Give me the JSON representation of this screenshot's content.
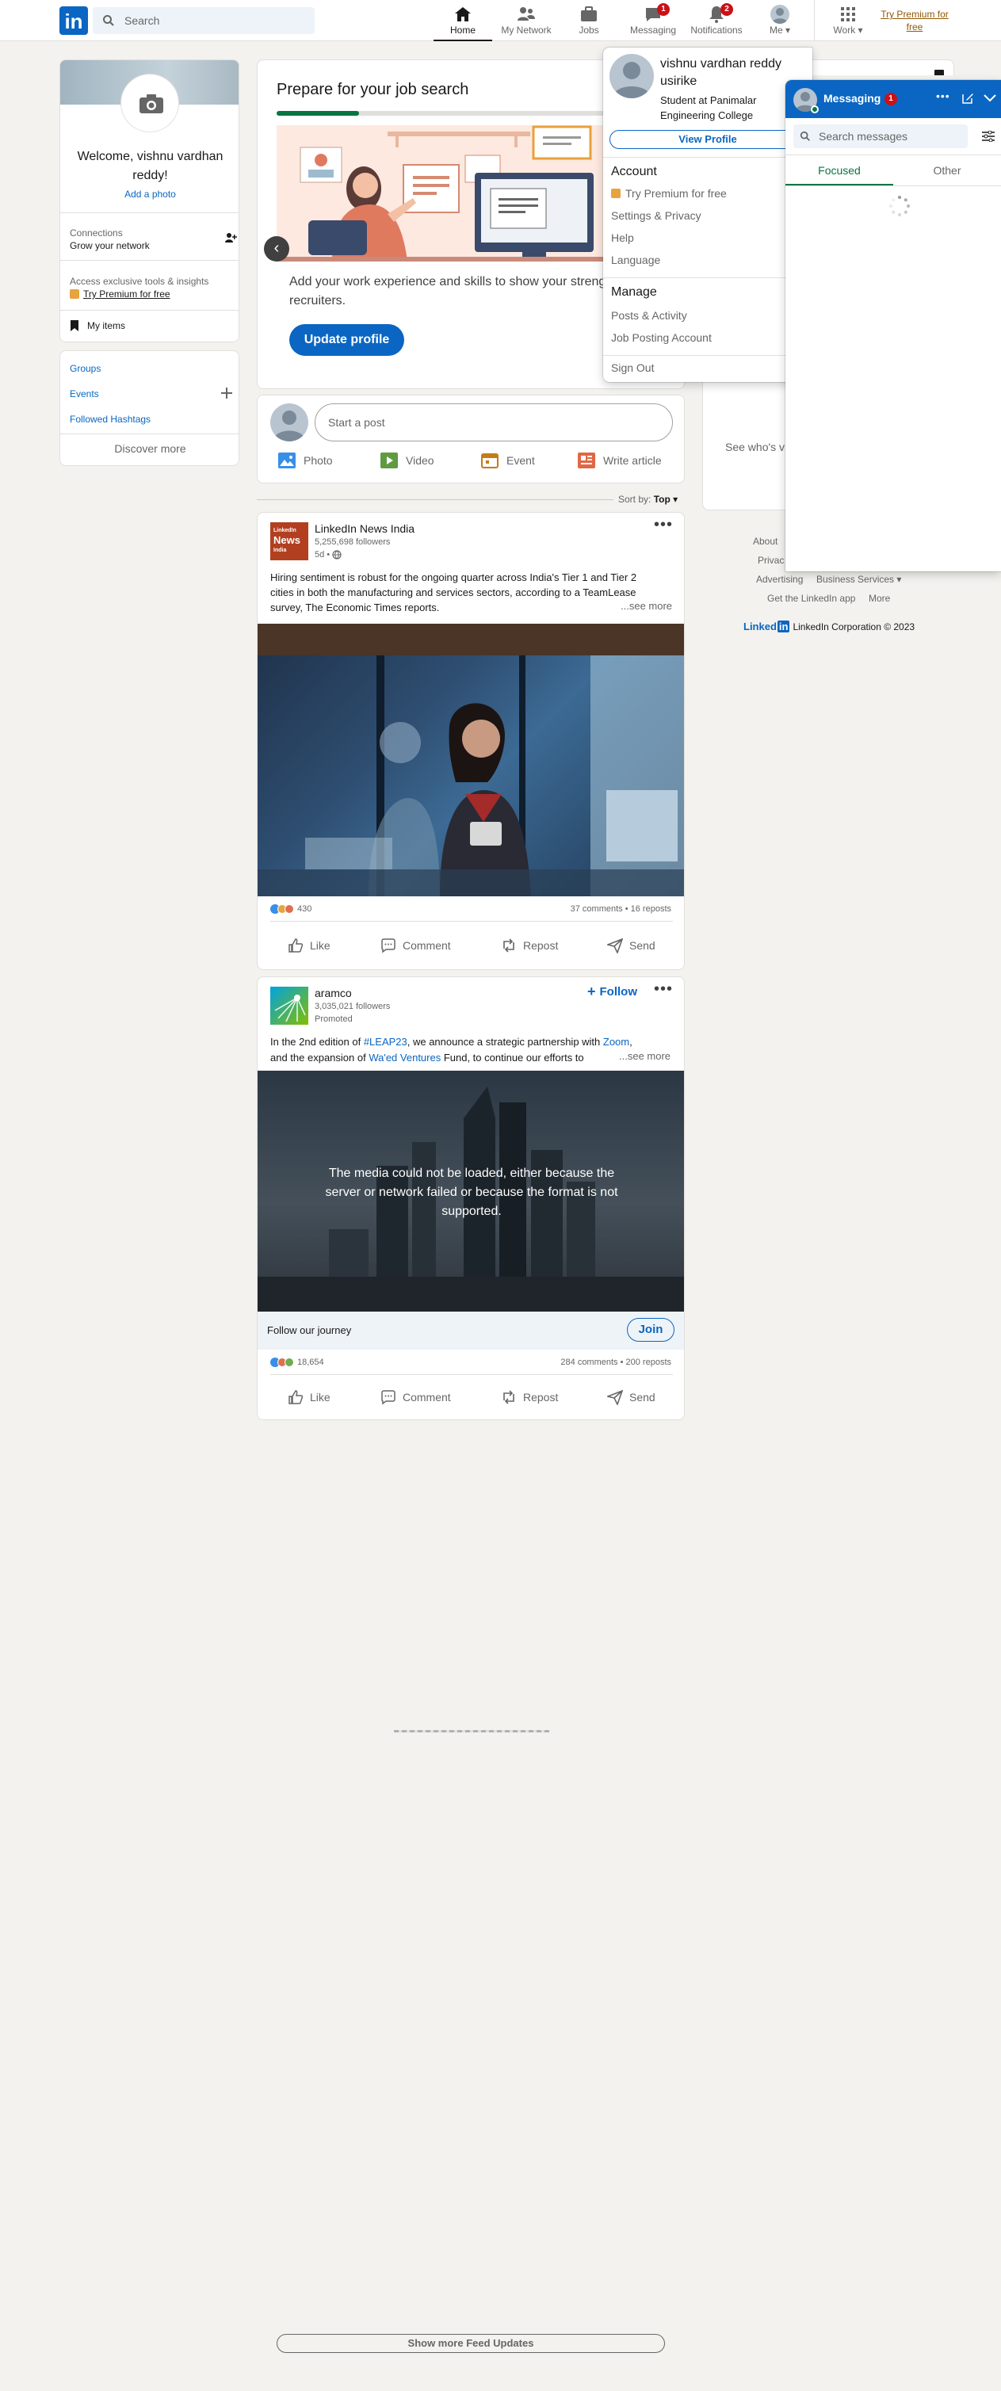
{
  "nav": {
    "search_placeholder": "Search",
    "home": "Home",
    "network": "My Network",
    "jobs": "Jobs",
    "messaging": "Messaging",
    "messaging_badge": "1",
    "notifications": "Notifications",
    "notifications_badge": "2",
    "me": "Me",
    "work": "Work",
    "premium_line1": "Try Premium for",
    "premium_line2": "free"
  },
  "profile_card": {
    "welcome_line1": "Welcome, vishnu vardhan",
    "welcome_line2": "reddy!",
    "add_photo": "Add a photo",
    "connections": "Connections",
    "grow": "Grow your network",
    "access": "Access exclusive tools & insights",
    "premium": "Try Premium for free",
    "my_items": "My items"
  },
  "links_card": {
    "groups": "Groups",
    "events": "Events",
    "hashtags": "Followed Hashtags",
    "discover": "Discover more"
  },
  "job_card": {
    "title": "Prepare for your job search",
    "body_line1": "Add your work experience and skills to show your streng",
    "body_line2": "recruiters.",
    "button": "Update profile"
  },
  "share_box": {
    "start_post": "Start a post",
    "photo": "Photo",
    "video": "Video",
    "event": "Event",
    "article": "Write article"
  },
  "sort": {
    "label": "Sort by:",
    "value": "Top"
  },
  "post1": {
    "author": "LinkedIn News India",
    "logo_text_1": "LinkedIn",
    "logo_text_2": "News",
    "logo_text_3": "India",
    "followers": "5,255,698 followers",
    "time": "5d •",
    "text_line1": "Hiring sentiment is robust for the ongoing quarter across India's Tier 1 and Tier 2",
    "text_line2": "cities in both the manufacturing and services sectors, according to a TeamLease",
    "text_line3": "survey, The Economic Times reports.",
    "see_more": "...see more",
    "reactions": "430",
    "comments": "37 comments • 16 reposts",
    "like": "Like",
    "comment": "Comment",
    "repost": "Repost",
    "send": "Send"
  },
  "post2": {
    "author": "aramco",
    "followers": "3,035,021 followers",
    "promoted": "Promoted",
    "follow": "Follow",
    "text_l1_a": "In the 2nd edition of ",
    "text_l1_tag": "#LEAP23",
    "text_l1_b": ", we announce a strategic partnership with ",
    "text_l1_zoom": "Zoom",
    "text_l1_c": ",",
    "text_l2_a": "and the expansion of ",
    "text_l2_waed": "Wa'ed Ventures",
    "text_l2_b": " Fund, to continue our efforts to",
    "see_more": "...see more",
    "media_error_l1": "The media could not be loaded, either because the",
    "media_error_l2": "server or network failed or because the format is not",
    "media_error_l3": "supported.",
    "cta_text": "Follow our journey",
    "cta_button": "Join",
    "reactions": "18,654",
    "comments": "284 comments • 200 reposts",
    "like": "Like",
    "comment": "Comment",
    "repost": "Repost",
    "send": "Send"
  },
  "show_more": "Show more Feed Updates",
  "right_rail": {
    "see_who": "See who's v"
  },
  "footer": {
    "about": "About",
    "privacy": "Privac",
    "advertising": "Advertising",
    "business": "Business Services",
    "get_app": "Get the LinkedIn app",
    "more": "More",
    "brand_1": "Linked",
    "brand_2": "in",
    "copyright": "LinkedIn Corporation © 2023"
  },
  "me_menu": {
    "name_line1": "vishnu vardhan reddy",
    "name_line2": "usirike",
    "headline_line1": "Student at Panimalar",
    "headline_line2": "Engineering College",
    "view_profile": "View Profile",
    "account_title": "Account",
    "premium": "Try Premium for free",
    "settings": "Settings & Privacy",
    "help": "Help",
    "language": "Language",
    "manage_title": "Manage",
    "posts": "Posts & Activity",
    "job_posting": "Job Posting Account",
    "sign_out": "Sign Out"
  },
  "messaging": {
    "title": "Messaging",
    "badge": "1",
    "search_placeholder": "Search messages",
    "tab_focused": "Focused",
    "tab_other": "Other"
  },
  "colors": {
    "brand_blue": "#0a66c2",
    "badge_red": "#cc1016",
    "premium_gold": "#915907",
    "background": "#f3f2ef"
  }
}
